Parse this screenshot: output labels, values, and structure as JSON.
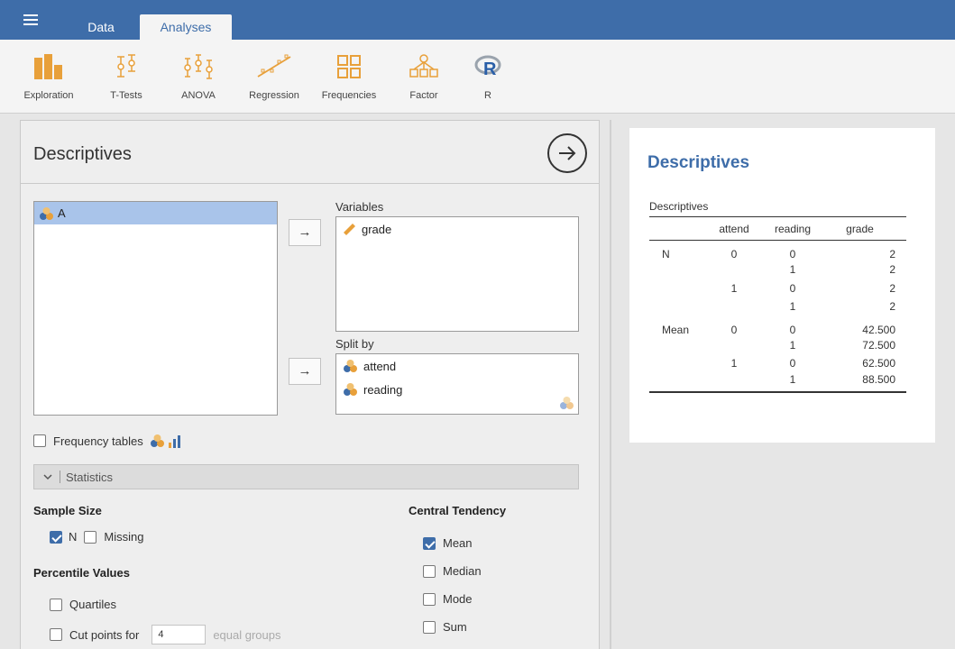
{
  "tabs": {
    "data": "Data",
    "analyses": "Analyses"
  },
  "toolbar": {
    "exploration": "Exploration",
    "ttests": "T-Tests",
    "anova": "ANOVA",
    "regression": "Regression",
    "frequencies": "Frequencies",
    "factor": "Factor",
    "r": "R"
  },
  "options": {
    "title": "Descriptives",
    "source_items": [
      "A"
    ],
    "variables_label": "Variables",
    "variables": [
      "grade"
    ],
    "splitby_label": "Split by",
    "splitby": [
      "attend",
      "reading"
    ],
    "frequency_tables": {
      "label": "Frequency tables",
      "checked": false
    },
    "statistics_label": "Statistics",
    "sample_size": {
      "heading": "Sample Size",
      "n": {
        "label": "N",
        "checked": true
      },
      "missing": {
        "label": "Missing",
        "checked": false
      }
    },
    "percentile": {
      "heading": "Percentile Values",
      "quartiles": {
        "label": "Quartiles",
        "checked": false
      },
      "cutpoints": {
        "label": "Cut points for",
        "value": "4",
        "suffix": "equal groups",
        "checked": false
      }
    },
    "central_tendency": {
      "heading": "Central Tendency",
      "mean": {
        "label": "Mean",
        "checked": true
      },
      "median": {
        "label": "Median",
        "checked": false
      },
      "mode": {
        "label": "Mode",
        "checked": false
      },
      "sum": {
        "label": "Sum",
        "checked": false
      }
    }
  },
  "results": {
    "title": "Descriptives",
    "table_title": "Descriptives",
    "columns": [
      "",
      "attend",
      "reading",
      "grade"
    ],
    "rows": [
      [
        "N",
        "0",
        "0",
        "2"
      ],
      [
        "",
        "",
        "1",
        "2"
      ],
      [
        "",
        "1",
        "0",
        "2"
      ],
      [
        "",
        "",
        "1",
        "2"
      ],
      [
        "Mean",
        "0",
        "0",
        "42.500"
      ],
      [
        "",
        "",
        "1",
        "72.500"
      ],
      [
        "",
        "1",
        "0",
        "62.500"
      ],
      [
        "",
        "",
        "1",
        "88.500"
      ]
    ]
  },
  "colors": {
    "brand": "#3e6da9",
    "toolbar_icon": "#e8a03a",
    "selection": "#a9c4ea"
  }
}
